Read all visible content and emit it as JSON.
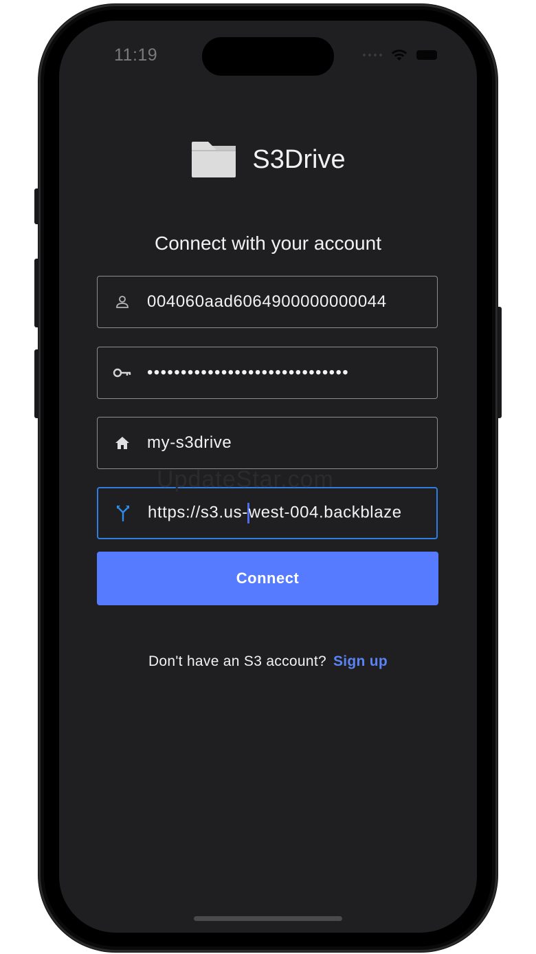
{
  "status_bar": {
    "time": "11:19"
  },
  "app": {
    "name": "S3Drive"
  },
  "login": {
    "heading": "Connect with your account",
    "fields": [
      {
        "icon": "person-icon",
        "value": "004060aad6064900000000044"
      },
      {
        "icon": "key-icon",
        "value": "••••••••••••••••••••••••••••••"
      },
      {
        "icon": "home-icon",
        "value": "my-s3drive"
      },
      {
        "icon": "fork-icon",
        "value_before_caret": "https://s3.us-",
        "value_after_caret": "west-004.backblaze"
      }
    ],
    "connect_label": "Connect",
    "signup_prompt": "Don't have an S3 account?",
    "signup_link": "Sign up"
  },
  "watermark": "UpdateStar.com",
  "colors": {
    "screen_bg": "#1f1f21",
    "accent": "#577bff",
    "focus_border": "#2f7de1",
    "link": "#5b84f2"
  }
}
